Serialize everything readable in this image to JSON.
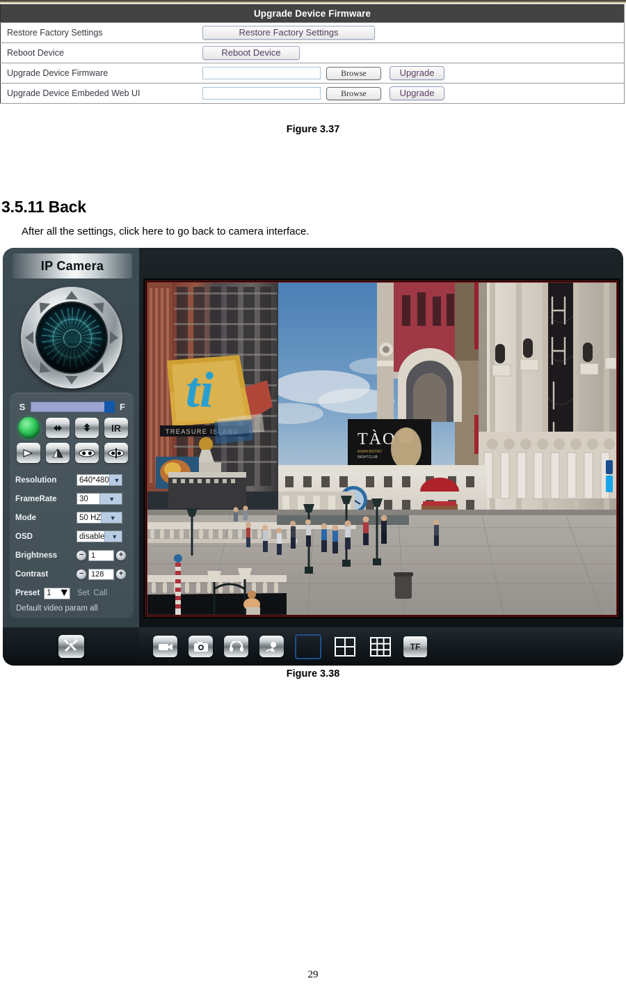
{
  "document": {
    "page_number": "29",
    "figure_caption_top": "Figure 3.37",
    "figure_caption_bottom": "Figure 3.38",
    "section_heading": "3.5.11 Back",
    "section_body": "After all the settings, click here to go back to camera interface."
  },
  "firmware_table": {
    "title": "Upgrade Device Firmware",
    "rows": [
      {
        "label": "Restore Factory Settings",
        "control": "button",
        "button_label": "Restore Factory Settings"
      },
      {
        "label": "Reboot Device",
        "control": "button",
        "button_label": "Reboot Device"
      },
      {
        "label": "Upgrade Device Firmware",
        "control": "file",
        "field_value": "",
        "browse_label": "Browse",
        "action_label": "Upgrade"
      },
      {
        "label": "Upgrade Device Embeded Web UI",
        "control": "file",
        "field_value": "",
        "browse_label": "Browse",
        "action_label": "Upgrade"
      }
    ]
  },
  "camera_ui": {
    "title": "IP Camera",
    "ptz": {
      "directions": [
        "up",
        "up-right",
        "right",
        "down-right",
        "down",
        "down-left",
        "left",
        "up-left"
      ]
    },
    "speed": {
      "slow_label": "S",
      "fast_label": "F",
      "value": 92
    },
    "control_buttons": [
      {
        "name": "status-led",
        "icon": "green-led-icon"
      },
      {
        "name": "horizontal-patrol",
        "icon": "left-right-arrow-icon"
      },
      {
        "name": "vertical-patrol",
        "icon": "up-down-arrow-icon"
      },
      {
        "name": "infrared-toggle",
        "icon": "ir-icon",
        "label": "IR"
      },
      {
        "name": "play",
        "icon": "play-icon"
      },
      {
        "name": "flip",
        "icon": "flip-icon"
      },
      {
        "name": "mirror",
        "icon": "mirror-icon"
      },
      {
        "name": "mirror-flip",
        "icon": "mirror-flip-icon"
      }
    ],
    "settings": [
      {
        "label": "Resolution",
        "type": "select",
        "value": "640*480"
      },
      {
        "label": "FrameRate",
        "type": "select",
        "value": "30"
      },
      {
        "label": "Mode",
        "type": "select",
        "value": "50 HZ"
      },
      {
        "label": "OSD",
        "type": "select",
        "value": "disable"
      },
      {
        "label": "Brightness",
        "type": "stepper",
        "value": "1"
      },
      {
        "label": "Contrast",
        "type": "stepper",
        "value": "128"
      }
    ],
    "preset": {
      "label": "Preset",
      "value": "1",
      "set_label": "Set",
      "call_label": "Call"
    },
    "default_param_label": "Default video param all",
    "toolbar": [
      {
        "name": "settings-wrench",
        "icon": "wrench-icon"
      },
      {
        "name": "record",
        "icon": "video-camera-icon"
      },
      {
        "name": "snapshot",
        "icon": "photo-camera-icon"
      },
      {
        "name": "audio",
        "icon": "headphone-icon"
      },
      {
        "name": "talk",
        "icon": "microphone-icon"
      },
      {
        "name": "single-view",
        "icon": "one-channel-icon"
      },
      {
        "name": "quad-view",
        "icon": "four-channel-icon"
      },
      {
        "name": "nine-view",
        "icon": "nine-channel-icon"
      },
      {
        "name": "tf-card",
        "icon": "tf-card-icon",
        "label": "TF"
      }
    ],
    "video_scrollbar": {
      "name": "zoom-slider"
    }
  },
  "colors": {
    "table_header_bg": "#434343",
    "button_text": "#5b3d63",
    "panel_bg": "#3d4b52",
    "led_green": "#39cf63",
    "slider_blue": "#1257a8",
    "accent_blue": "#17a5e8"
  }
}
